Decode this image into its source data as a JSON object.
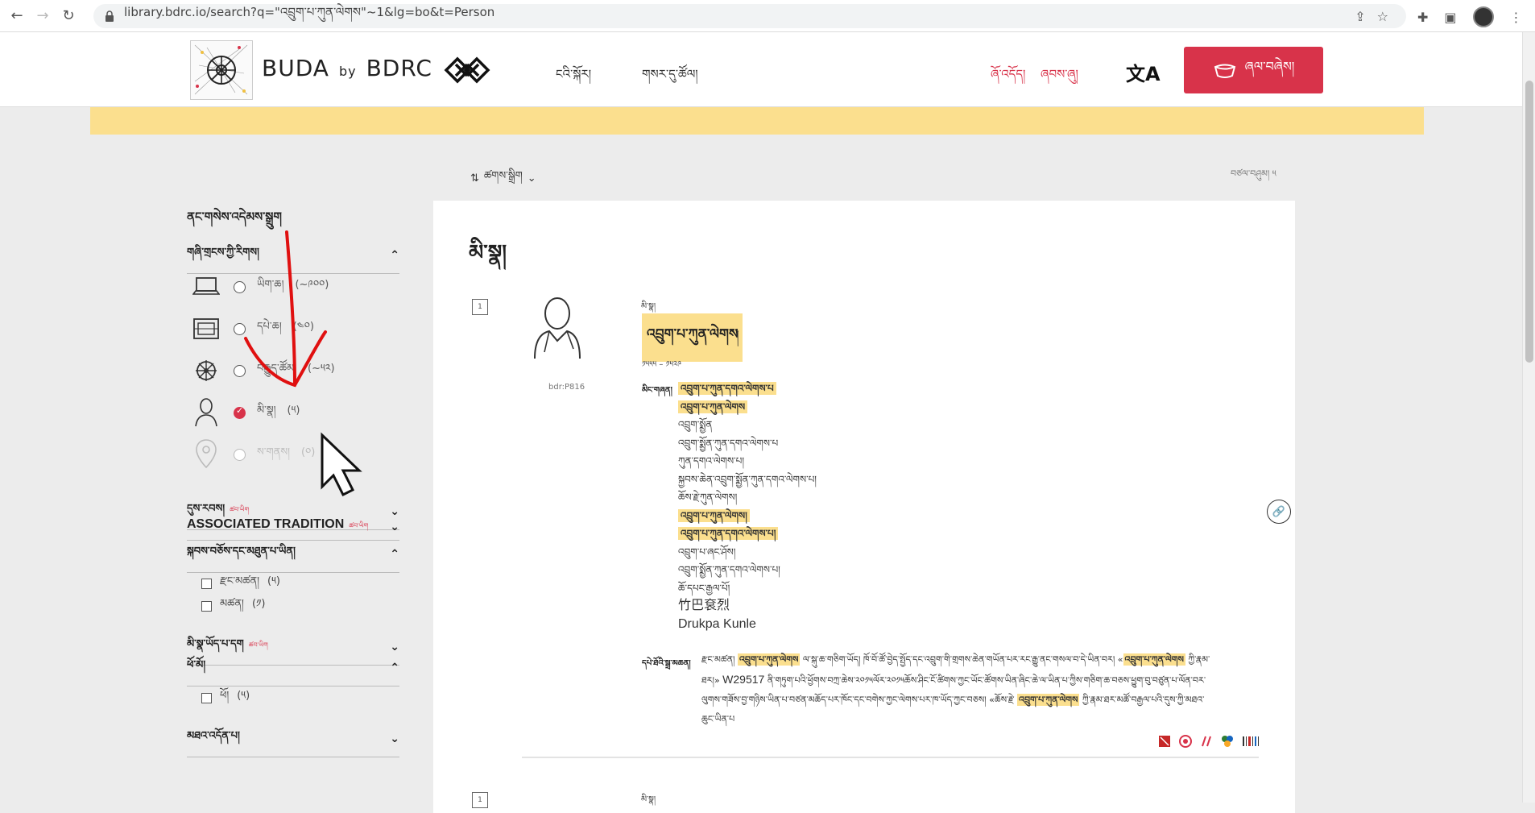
{
  "browser": {
    "url": "library.bdrc.io/search?q=\"འབྲུག་པ་ཀུན་ལེགས\"~1&lg=bo&t=Person"
  },
  "header": {
    "brand_main": "BUDA",
    "brand_by": "by",
    "brand_org": "BDRC",
    "nav": [
      "ངའི་སྐོར།",
      "གསར་དུ་ཚོལ།"
    ],
    "links": [
      "ཞོ་འདོད།",
      "ཞབས་ཞུ།"
    ],
    "lang_icon": "文A",
    "login_label": "ཞལ་བཞེས།"
  },
  "toolbar": {
    "sort_label": "ཚགས་སྒྲིག",
    "page_count": "བཙལ་བཤུམ། ༥"
  },
  "sidebar": {
    "title": "ནང་གསེས་འདེམས་སྒྲུག",
    "types_header": "གཞི་གྲངས་ཀྱི་རིགས།",
    "types": [
      {
        "label": "ཡིག་ཆ།",
        "count": "(~༩༠༠)"
      },
      {
        "label": "དཔེ་ཆ།",
        "count": "(༤༠)"
      },
      {
        "label": "བརྒྱུད་ཚོམ།",
        "count": "(~༥༢)"
      },
      {
        "label": "མི་སྣ།",
        "count": "(༥)"
      },
      {
        "label": "ས་གནས།",
        "count": "(༠)"
      }
    ],
    "sections": [
      {
        "label": "དུས་རབས།",
        "sub": "ཚབ་ཡིག"
      },
      {
        "label": "ASSOCIATED TRADITION",
        "sub": "ཚབ་ཡིག"
      },
      {
        "label": "སྐབས་བཅོས་དང་མཐུན་པ་ཡིན།",
        "sub": ""
      }
    ],
    "tradition_options": [
      {
        "label": "རྫང་མཚན།",
        "count": "(༥)"
      },
      {
        "label": "མཚན།",
        "count": "(༡)"
      }
    ],
    "sections2": [
      {
        "label": "མི་སྣ་ཡོད་པ་དག",
        "sub": "ཚབ་ཡིག"
      },
      {
        "label": "ཕོ་མོ།",
        "sub": ""
      }
    ],
    "gender_options": [
      {
        "label": "ཕོ།",
        "count": "(༥)"
      }
    ],
    "last_section": "མཐའ་འདོན་པ།"
  },
  "result": {
    "heading": "མི་སྣ།",
    "row1_num": "1",
    "bdr_id": "bdr:P816",
    "type_label": "མི་སྣ།",
    "name": "འབྲུག་པ་ཀུན་ལེགས",
    "name_shad": "།",
    "dates": "༡༥༥༥ – ༡༥༢༩",
    "names_label": "མིང་གཞན།",
    "names": [
      {
        "text": "འབྲུག་པ་ཀུན་དགའ་ལེགས་པ",
        "hl": true
      },
      {
        "text": "འབྲུག་པ་ཀུན་ལེགས",
        "hl": true
      },
      {
        "text": "འབྲུག་སྨྱོན",
        "hl": false
      },
      {
        "text": "འབྲུག་སྨྱོན་ཀུན་དགའ་ལེགས་པ",
        "hl": false
      },
      {
        "text": "ཀུན་དགའ་ལེགས་པ།",
        "hl": false
      },
      {
        "text": "སྐྱབས་ཆེན་འབྲུག་སྨྱོན་ཀུན་དགའ་ལེགས་པ།",
        "hl": false
      },
      {
        "text": "ཆོས་རྗེ་ཀུན་ལེགས།",
        "hl": false
      },
      {
        "text": "འབྲུག་པ་ཀུན་ལེགས།",
        "hl": true
      },
      {
        "text": "འབྲུག་པ་ཀུན་དགའ་ལེགས་པ།",
        "hl": true
      },
      {
        "text": "འབྲུག་པ་ཞང་ཤོས།",
        "hl": false
      },
      {
        "text": "འབྲུག་སྨྱོན་ཀུན་དགའ་ལེགས་པ།",
        "hl": false
      },
      {
        "text": "ཆོ་དཔང་རྒྱལ་པོ།",
        "hl": false
      },
      {
        "text": "竹巴袞烈",
        "hl": false,
        "latin": true
      },
      {
        "text": "Drukpa Kunle",
        "hl": false,
        "latin": true
      }
    ],
    "bio_label": "དཔེ་ཐོའི་སྒྲ་མཆན།",
    "bio_text_1": "རྫང་མཚན། ",
    "bio_hl_1": "འབྲུག་པ་ཀུན་ལེགས",
    "bio_text_2": " ལ་སྐུ་ཆ་གཅིག་ཡོད། ཁོ་བོ་ཚོ་བྱེད་སྤྱོད་དང་འབྲུག་གི་གྲགས་ཆེན་གཡོན་པར་རང་རྒྱུ་ནང་གསལ་བ་དེ་ཡིན་བར། «",
    "bio_hl_2": "འབྲུག་པ་ཀུན་ལེགས",
    "bio_text_3": " ཀྱི་རྣམ་ཐར།» ",
    "bio_latin": "W29517",
    "bio_text_4": " ནི་གཏུག་པའི་ཕྱོགས་བཀྲ་ཆེས་༢༠༡༥ལོར་༢༠༡༥ཆོས་ཤིང་ངོ་ཚིགས་ཀྱང་ཡོང་ཚོགས་ཡིན་ཞིང་ཆེ་ལ་ཡིན་པ་ཀྱིས་གཅིག་ཆ་བཅས་ཕྱུག་བུ་བཙུན་པ་ལོན་བར་ལུགས་གཟོས་བྱ་གཉིས་ཡིན་པ་བཙན་མཆོད་པར་ཁོང་དང་བགེས་ཀྱང་ལེགས་པར་ཁ་ཡོད་ཀྱང་བཅས། «ཆོས་རྗེ་ ",
    "bio_hl_3": "འབྲུག་པ་ཀུན་ལེགས",
    "bio_text_5": " ཀྱི་རྣམ་ཐར་མཚོ་བརྒྱལ་པའི་དུས་ཀྱི་མཐའ་ཆུང་ཡིན་པ",
    "row2_num": "1",
    "type_label2": "མི་སྣ།"
  },
  "colors": {
    "accent": "#d8334a",
    "highlight": "#fbdf8e",
    "banner": "#fbdf8e"
  }
}
